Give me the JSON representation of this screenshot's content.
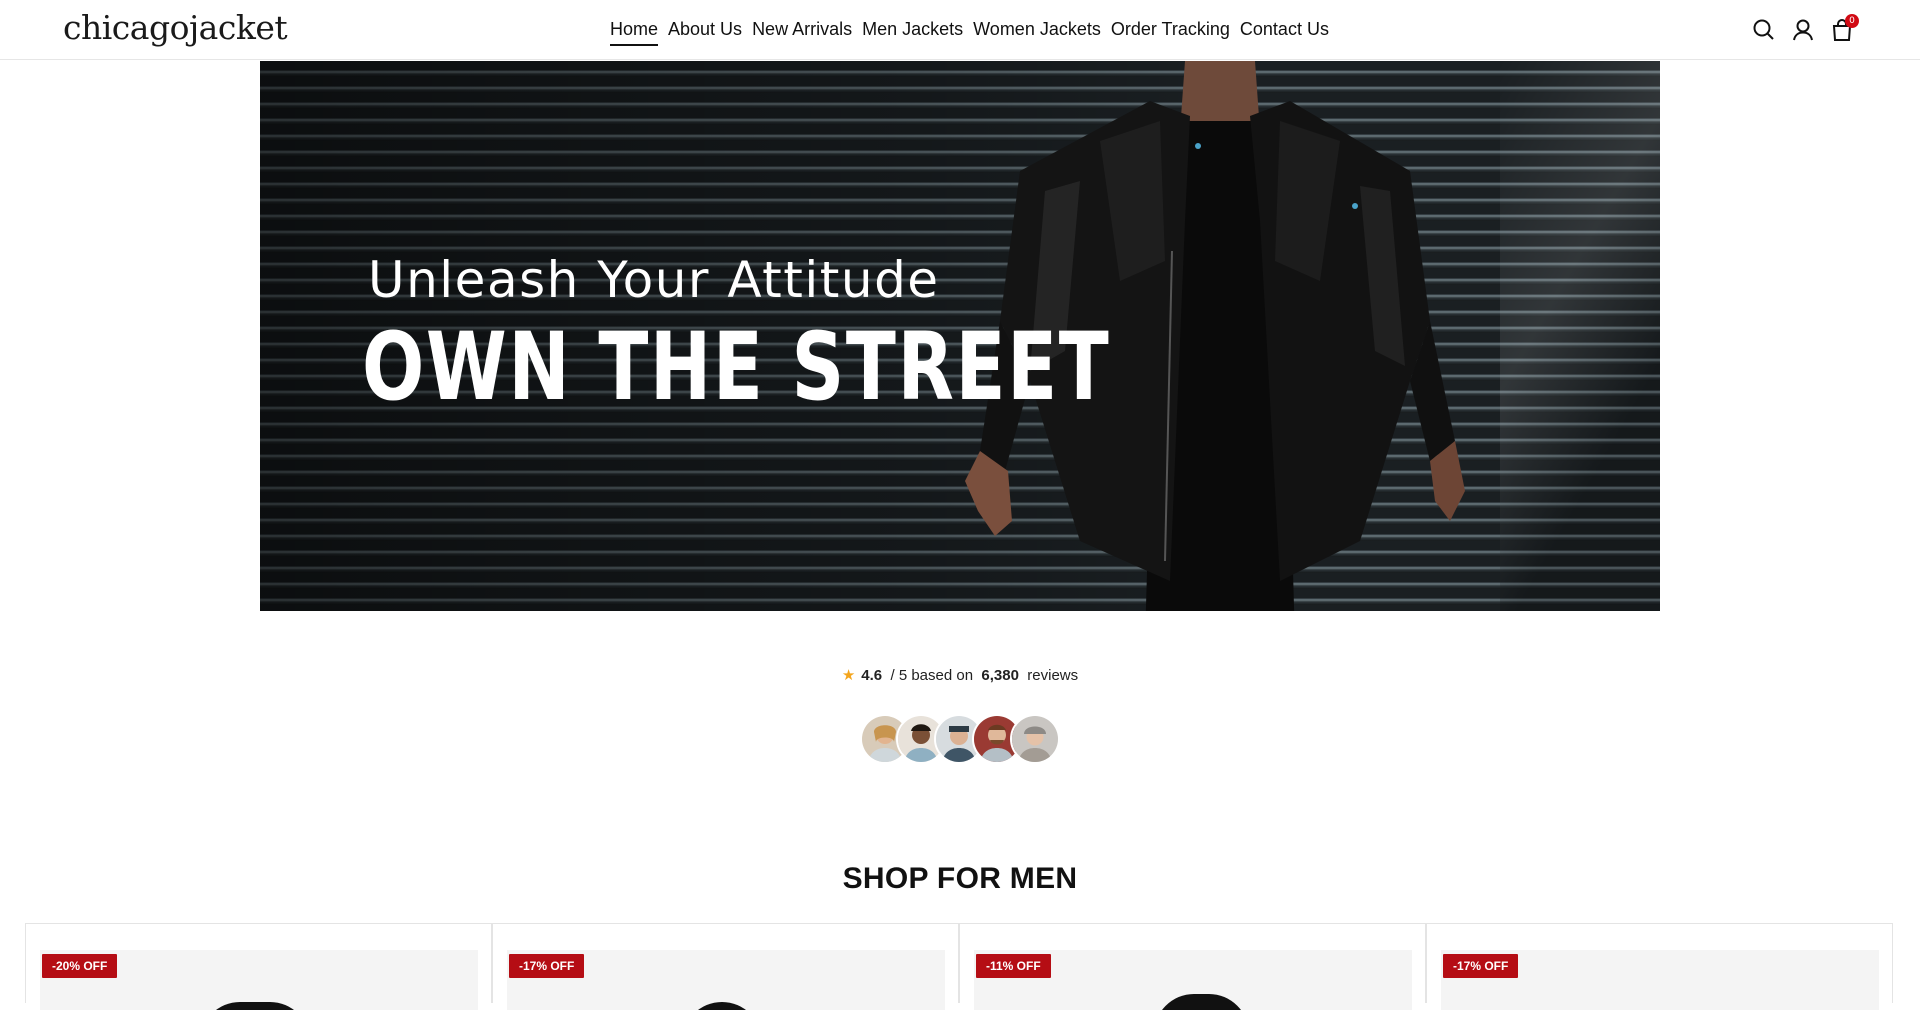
{
  "brand": {
    "logo": "chicagojacket"
  },
  "nav": {
    "items": [
      {
        "label": "Home",
        "active": true
      },
      {
        "label": "About Us",
        "active": false
      },
      {
        "label": "New Arrivals",
        "active": false
      },
      {
        "label": "Men Jackets",
        "active": false
      },
      {
        "label": "Women Jackets",
        "active": false
      },
      {
        "label": "Order Tracking",
        "active": false
      },
      {
        "label": "Contact Us",
        "active": false
      }
    ]
  },
  "header_icons": {
    "search": "search-icon",
    "account": "user-icon",
    "cart": "shopping-bag-icon",
    "cart_count": "0"
  },
  "hero": {
    "subtitle": "Unleash Your Attitude",
    "title": "OWN THE STREET"
  },
  "reviews": {
    "star": "★",
    "score": "4.6",
    "out_of": "/ 5 based on",
    "count": "6,380",
    "suffix": "reviews",
    "avatar_count": 5
  },
  "shop": {
    "title": "SHOP FOR MEN",
    "products": [
      {
        "badge": "-20% OFF"
      },
      {
        "badge": "-17% OFF"
      },
      {
        "badge": "-11% OFF"
      },
      {
        "badge": "-17% OFF"
      }
    ]
  },
  "colors": {
    "badge": "#b50d14",
    "cart_badge": "#d10a14",
    "star": "#f4a51c",
    "text": "#111111"
  }
}
